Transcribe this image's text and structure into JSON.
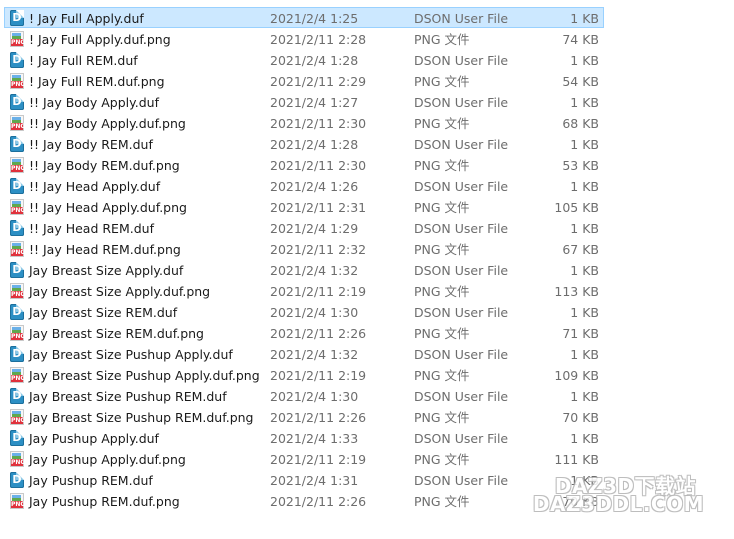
{
  "files": [
    {
      "name": "! Jay Full Apply.duf",
      "date": "2021/2/4 1:25",
      "type": "DSON User File",
      "size": "1 KB",
      "icon": "duf-file-icon",
      "selected": true
    },
    {
      "name": "! Jay Full Apply.duf.png",
      "date": "2021/2/11 2:28",
      "type": "PNG 文件",
      "size": "74 KB",
      "icon": "png-file-icon"
    },
    {
      "name": "! Jay Full REM.duf",
      "date": "2021/2/4 1:28",
      "type": "DSON User File",
      "size": "1 KB",
      "icon": "duf-file-icon"
    },
    {
      "name": "! Jay Full REM.duf.png",
      "date": "2021/2/11 2:29",
      "type": "PNG 文件",
      "size": "54 KB",
      "icon": "png-file-icon"
    },
    {
      "name": "!! Jay Body Apply.duf",
      "date": "2021/2/4 1:27",
      "type": "DSON User File",
      "size": "1 KB",
      "icon": "duf-file-icon"
    },
    {
      "name": "!! Jay Body Apply.duf.png",
      "date": "2021/2/11 2:30",
      "type": "PNG 文件",
      "size": "68 KB",
      "icon": "png-file-icon"
    },
    {
      "name": "!! Jay Body REM.duf",
      "date": "2021/2/4 1:28",
      "type": "DSON User File",
      "size": "1 KB",
      "icon": "duf-file-icon"
    },
    {
      "name": "!! Jay Body REM.duf.png",
      "date": "2021/2/11 2:30",
      "type": "PNG 文件",
      "size": "53 KB",
      "icon": "png-file-icon"
    },
    {
      "name": "!! Jay Head Apply.duf",
      "date": "2021/2/4 1:26",
      "type": "DSON User File",
      "size": "1 KB",
      "icon": "duf-file-icon"
    },
    {
      "name": "!! Jay Head Apply.duf.png",
      "date": "2021/2/11 2:31",
      "type": "PNG 文件",
      "size": "105 KB",
      "icon": "png-file-icon"
    },
    {
      "name": "!! Jay Head REM.duf",
      "date": "2021/2/4 1:29",
      "type": "DSON User File",
      "size": "1 KB",
      "icon": "duf-file-icon"
    },
    {
      "name": "!! Jay Head REM.duf.png",
      "date": "2021/2/11 2:32",
      "type": "PNG 文件",
      "size": "67 KB",
      "icon": "png-file-icon"
    },
    {
      "name": "Jay  Breast Size Apply.duf",
      "date": "2021/2/4 1:32",
      "type": "DSON User File",
      "size": "1 KB",
      "icon": "duf-file-icon"
    },
    {
      "name": "Jay  Breast Size Apply.duf.png",
      "date": "2021/2/11 2:19",
      "type": "PNG 文件",
      "size": "113 KB",
      "icon": "png-file-icon"
    },
    {
      "name": "Jay  Breast Size REM.duf",
      "date": "2021/2/4 1:30",
      "type": "DSON User File",
      "size": "1 KB",
      "icon": "duf-file-icon"
    },
    {
      "name": "Jay  Breast Size REM.duf.png",
      "date": "2021/2/11 2:26",
      "type": "PNG 文件",
      "size": "71 KB",
      "icon": "png-file-icon"
    },
    {
      "name": "Jay Breast Size Pushup Apply.duf",
      "date": "2021/2/4 1:32",
      "type": "DSON User File",
      "size": "1 KB",
      "icon": "duf-file-icon"
    },
    {
      "name": "Jay Breast Size Pushup Apply.duf.png",
      "date": "2021/2/11 2:19",
      "type": "PNG 文件",
      "size": "109 KB",
      "icon": "png-file-icon"
    },
    {
      "name": "Jay Breast Size Pushup REM.duf",
      "date": "2021/2/4 1:30",
      "type": "DSON User File",
      "size": "1 KB",
      "icon": "duf-file-icon"
    },
    {
      "name": "Jay Breast Size Pushup REM.duf.png",
      "date": "2021/2/11 2:26",
      "type": "PNG 文件",
      "size": "70 KB",
      "icon": "png-file-icon"
    },
    {
      "name": "Jay Pushup Apply.duf",
      "date": "2021/2/4 1:33",
      "type": "DSON User File",
      "size": "1 KB",
      "icon": "duf-file-icon"
    },
    {
      "name": "Jay Pushup Apply.duf.png",
      "date": "2021/2/11 2:19",
      "type": "PNG 文件",
      "size": "111 KB",
      "icon": "png-file-icon"
    },
    {
      "name": "Jay Pushup REM.duf",
      "date": "2021/2/4 1:31",
      "type": "DSON User File",
      "size": "1 KB",
      "icon": "duf-file-icon"
    },
    {
      "name": "Jay Pushup REM.duf.png",
      "date": "2021/2/11 2:26",
      "type": "PNG 文件",
      "size": "70 KB",
      "icon": "png-file-icon"
    }
  ],
  "icon_labels": {
    "duf": "D",
    "png": "PNG"
  },
  "watermark": {
    "line1": "DAZ3D下载站",
    "line2": "DAZ3DDL.COM"
  },
  "colors": {
    "selection": "#cce8ff",
    "selection_border": "#99d1ff",
    "meta_text": "#6d6d6d",
    "duf_icon": "#2c8fc4",
    "png_tag": "#e0313c"
  }
}
